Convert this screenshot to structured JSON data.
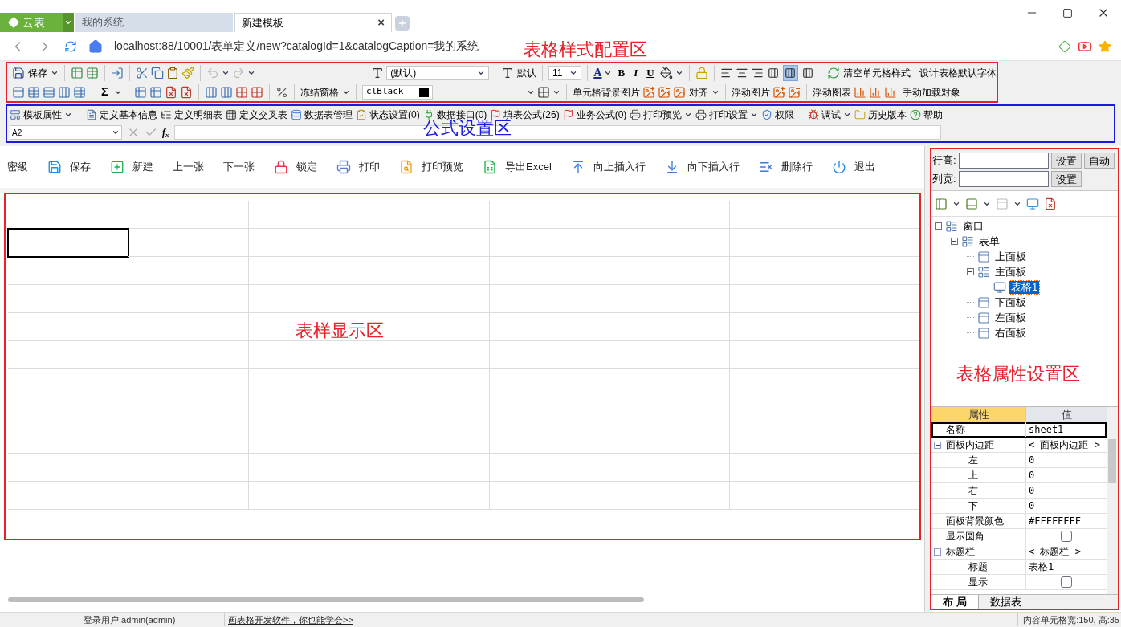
{
  "browser": {
    "brand": "云表",
    "tabs": [
      {
        "label": "我的系统",
        "selected": false
      },
      {
        "label": "新建模板",
        "selected": true
      }
    ],
    "close_tab": "×",
    "address": "localhost:88/10001/表单定义/new?catalogId=1&catalogCaption=我的系统"
  },
  "annotations": [
    {
      "label": "表格样式配置区",
      "color": "#e8202a"
    },
    {
      "label": "公式设置区",
      "color": "#1a1ae0"
    },
    {
      "label": "表样显示区",
      "color": "#e8202a"
    },
    {
      "label": "表格属性设置区",
      "color": "#e8202a"
    }
  ],
  "style_toolbar": {
    "save": "保存",
    "font": "(默认)",
    "default_font": "默认",
    "font_size": "11",
    "font_color": "A",
    "bold": "B",
    "italic": "I",
    "underline": "U",
    "justify_modes": [
      {
        "selected": false
      },
      {
        "selected": true
      },
      {
        "selected": false
      }
    ],
    "clear_style": "清空单元格样式",
    "default_font_design": "设计表格默认字体",
    "sum": "Σ",
    "freeze": "冻结窗格",
    "color_value": "clBlack",
    "bg_image": "单元格背景图片",
    "align": "对齐",
    "float_image": "浮动图片",
    "float_chart": "浮动图表",
    "manual_load": "手动加载对象"
  },
  "formula_toolbar": [
    {
      "label": "模板属性",
      "dropdown": true
    },
    {
      "label": "定义基本信息",
      "dropdown": false
    },
    {
      "label": "定义明细表",
      "dropdown": false
    },
    {
      "label": "定义交叉表",
      "dropdown": false
    },
    {
      "label": "数据表管理",
      "dropdown": false
    },
    {
      "label": "状态设置(0)",
      "dropdown": false
    },
    {
      "label": "数据接口(0)",
      "dropdown": false
    },
    {
      "label": "填表公式(26)",
      "dropdown": false
    },
    {
      "label": "业务公式(0)",
      "dropdown": false
    },
    {
      "label": "打印预览",
      "dropdown": true
    },
    {
      "label": "打印设置",
      "dropdown": true
    },
    {
      "label": "权限",
      "dropdown": false
    },
    {
      "label": "调试",
      "dropdown": true
    },
    {
      "label": "历史版本",
      "dropdown": false
    },
    {
      "label": "帮助",
      "dropdown": false
    }
  ],
  "formula_bar": {
    "cell_ref": "A2",
    "function_label": "f$_{x}$"
  },
  "actions": [
    {
      "label": "密級"
    },
    {
      "label": "保存"
    },
    {
      "label": "新建"
    },
    {
      "label": "上一张"
    },
    {
      "label": "下一张"
    },
    {
      "label": "锁定"
    },
    {
      "label": "打印"
    },
    {
      "label": "打印预览"
    },
    {
      "label": "导出Excel"
    },
    {
      "label": "向上插入行"
    },
    {
      "label": "向下插入行"
    },
    {
      "label": "删除行"
    },
    {
      "label": "退出"
    }
  ],
  "right_panel": {
    "row_height_label": "行高:",
    "col_width_label": "列宽:",
    "set_button": "设置",
    "auto_button": "自动",
    "set_button_2": "设置",
    "tree": [
      {
        "label": "窗口",
        "expanded": true,
        "selected": false,
        "children": [
          {
            "label": "表单",
            "expanded": true,
            "selected": false,
            "children": [
              {
                "label": "上面板",
                "selected": false
              },
              {
                "label": "主面板",
                "expanded": true,
                "selected": false,
                "children": [
                  {
                    "label": "表格1",
                    "selected": true
                  }
                ]
              },
              {
                "label": "下面板",
                "selected": false
              },
              {
                "label": "左面板",
                "selected": false
              },
              {
                "label": "右面板",
                "selected": false
              }
            ]
          }
        ]
      }
    ],
    "properties": {
      "columns": [
        "属性",
        "值"
      ],
      "rows": [
        {
          "kind": "text",
          "name": "名称",
          "value": "sheet1",
          "selected": true
        },
        {
          "kind": "group",
          "name": "面板内边距",
          "value": "< 面板内边距 >",
          "expanded": true,
          "selected": false,
          "children": [
            {
              "kind": "text",
              "name": "左",
              "value": "0",
              "selected": false
            },
            {
              "kind": "text",
              "name": "上",
              "value": "0",
              "selected": false
            },
            {
              "kind": "text",
              "name": "右",
              "value": "0",
              "selected": false
            },
            {
              "kind": "text",
              "name": "下",
              "value": "0",
              "selected": false
            }
          ]
        },
        {
          "kind": "text",
          "name": "面板背景颜色",
          "value": "#FFFFFFFF",
          "selected": false
        },
        {
          "kind": "check",
          "name": "显示圆角",
          "checked": false,
          "selected": false
        },
        {
          "kind": "group",
          "name": "标题栏",
          "value": "< 标题栏 >",
          "expanded": true,
          "selected": false,
          "children": [
            {
              "kind": "text",
              "name": "标题",
              "value": "表格1",
              "selected": false
            },
            {
              "kind": "check",
              "name": "显示",
              "checked": false,
              "selected": false
            }
          ]
        }
      ]
    },
    "bottom_tabs": [
      {
        "label": "布 局",
        "selected": true
      },
      {
        "label": "数据表",
        "selected": false
      }
    ]
  },
  "status_bar": {
    "user": "登录用户:admin(admin)",
    "link": "画表格开发软件，你也能学会>>",
    "cell_size": "内容单元格宽:150, 高:35"
  }
}
